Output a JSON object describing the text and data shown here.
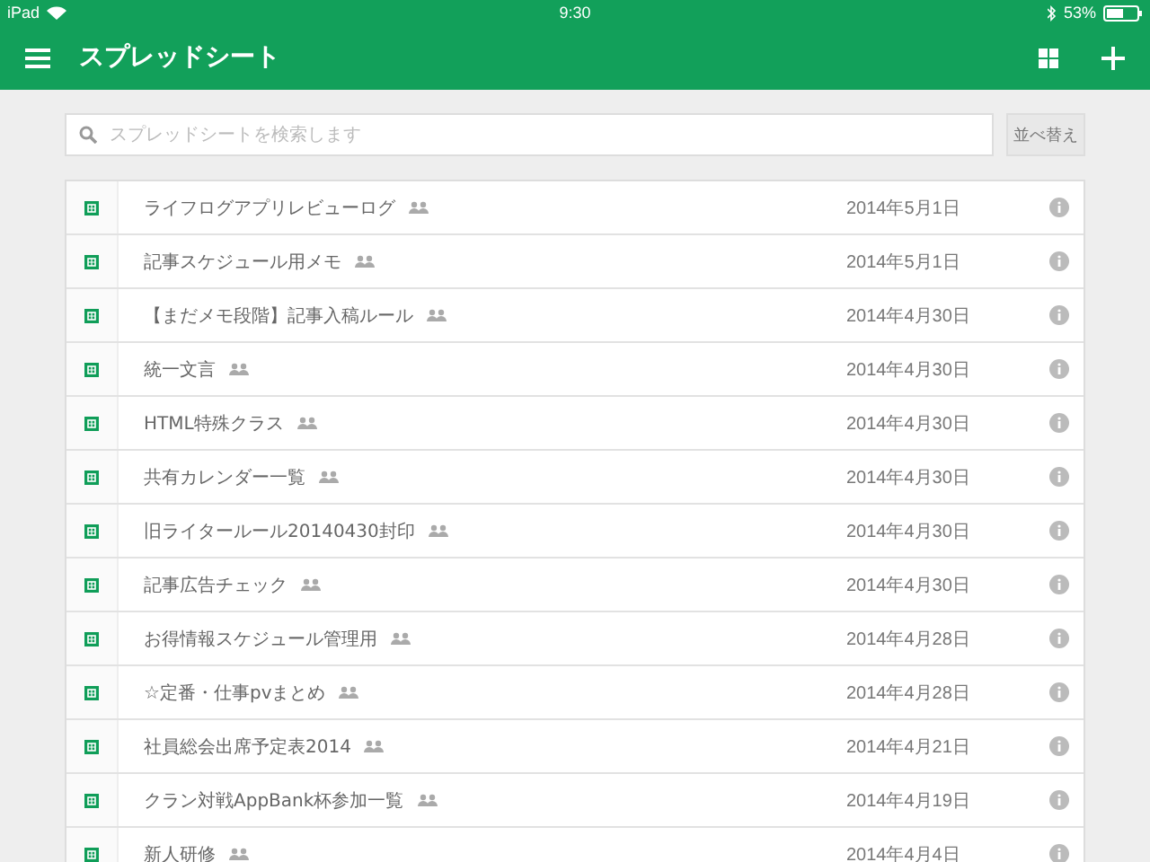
{
  "status_bar": {
    "device": "iPad",
    "time": "9:30",
    "battery": "53%"
  },
  "toolbar": {
    "title": "スプレッドシート"
  },
  "search": {
    "placeholder": "スプレッドシートを検索します"
  },
  "sort_button": "並べ替え",
  "files": [
    {
      "name": "ライフログアプリレビューログ",
      "shared": true,
      "date": "2014年5月1日"
    },
    {
      "name": "記事スケジュール用メモ",
      "shared": true,
      "date": "2014年5月1日"
    },
    {
      "name": "【まだメモ段階】記事入稿ルール",
      "shared": true,
      "date": "2014年4月30日"
    },
    {
      "name": "統一文言",
      "shared": true,
      "date": "2014年4月30日"
    },
    {
      "name": "HTML特殊クラス",
      "shared": true,
      "date": "2014年4月30日"
    },
    {
      "name": "共有カレンダー一覧",
      "shared": true,
      "date": "2014年4月30日"
    },
    {
      "name": "旧ライタールール20140430封印",
      "shared": true,
      "date": "2014年4月30日"
    },
    {
      "name": "記事広告チェック",
      "shared": true,
      "date": "2014年4月30日"
    },
    {
      "name": "お得情報スケジュール管理用",
      "shared": true,
      "date": "2014年4月28日"
    },
    {
      "name": "☆定番・仕事pvまとめ",
      "shared": true,
      "date": "2014年4月28日"
    },
    {
      "name": "社員総会出席予定表2014",
      "shared": true,
      "date": "2014年4月21日"
    },
    {
      "name": "クラン対戦AppBank杯参加一覧",
      "shared": true,
      "date": "2014年4月19日"
    },
    {
      "name": "新人研修",
      "shared": true,
      "date": "2014年4月4日"
    }
  ]
}
